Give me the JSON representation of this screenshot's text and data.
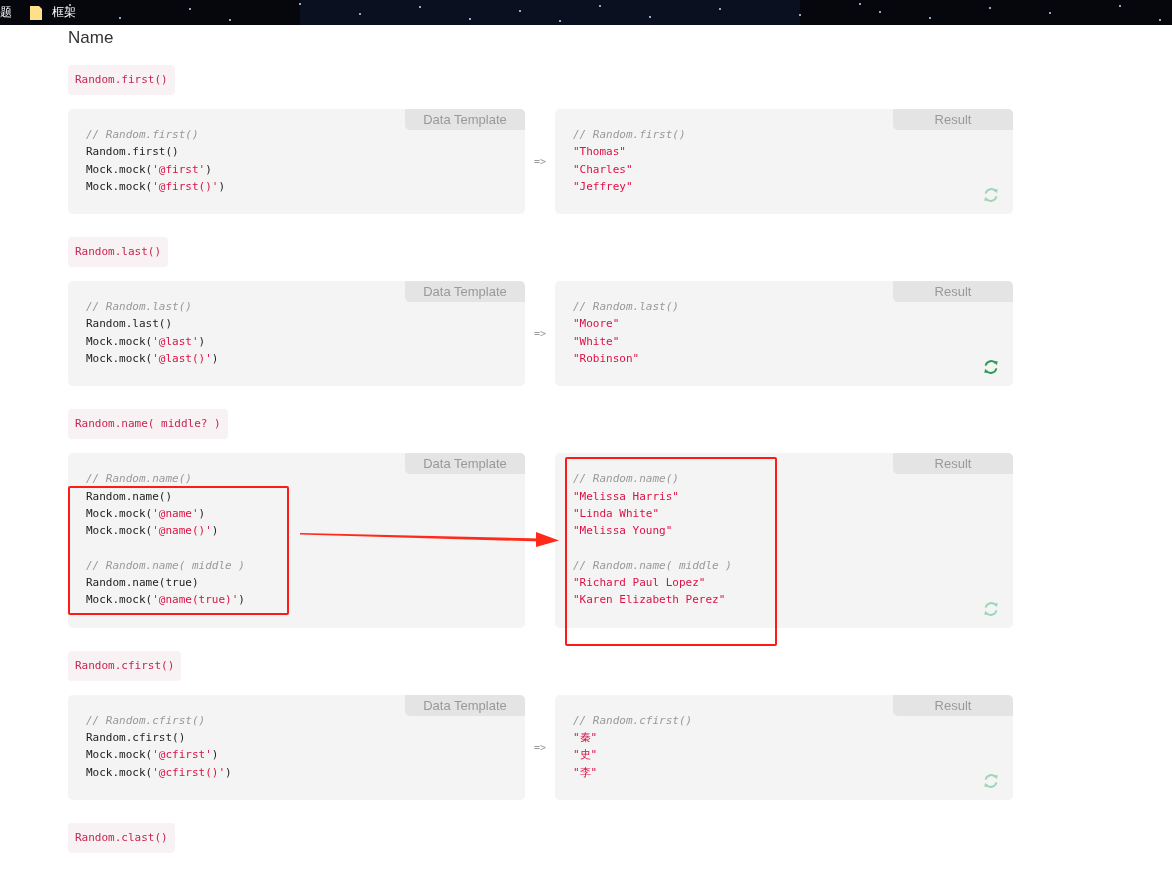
{
  "bookmarks_bar": {
    "items": [
      {
        "label": "题",
        "kind": "text"
      },
      {
        "label": "框架",
        "kind": "folder"
      }
    ]
  },
  "heading": "Name",
  "sections": [
    {
      "label": "Random.first()",
      "template_tab": "Data Template",
      "result_tab": "Result",
      "arrow_text": "=>",
      "annotated": false,
      "refresh_active": false,
      "template": [
        {
          "kind": "comment",
          "text": "// Random.first()"
        },
        {
          "kind": "code",
          "parts": [
            {
              "kind": "plain",
              "text": "Random.first()"
            }
          ]
        },
        {
          "kind": "code",
          "parts": [
            {
              "kind": "plain",
              "text": "Mock.mock("
            },
            {
              "kind": "string",
              "text": "'@first'"
            },
            {
              "kind": "plain",
              "text": ")"
            }
          ]
        },
        {
          "kind": "code",
          "parts": [
            {
              "kind": "plain",
              "text": "Mock.mock("
            },
            {
              "kind": "string",
              "text": "'@first()'"
            },
            {
              "kind": "plain",
              "text": ")"
            }
          ]
        }
      ],
      "result": [
        {
          "kind": "comment",
          "text": "// Random.first()"
        },
        {
          "kind": "string",
          "text": "\"Thomas\""
        },
        {
          "kind": "string",
          "text": "\"Charles\""
        },
        {
          "kind": "string",
          "text": "\"Jeffrey\""
        }
      ]
    },
    {
      "label": "Random.last()",
      "template_tab": "Data Template",
      "result_tab": "Result",
      "arrow_text": "=>",
      "annotated": false,
      "refresh_active": true,
      "template": [
        {
          "kind": "comment",
          "text": "// Random.last()"
        },
        {
          "kind": "code",
          "parts": [
            {
              "kind": "plain",
              "text": "Random.last()"
            }
          ]
        },
        {
          "kind": "code",
          "parts": [
            {
              "kind": "plain",
              "text": "Mock.mock("
            },
            {
              "kind": "string",
              "text": "'@last'"
            },
            {
              "kind": "plain",
              "text": ")"
            }
          ]
        },
        {
          "kind": "code",
          "parts": [
            {
              "kind": "plain",
              "text": "Mock.mock("
            },
            {
              "kind": "string",
              "text": "'@last()'"
            },
            {
              "kind": "plain",
              "text": ")"
            }
          ]
        }
      ],
      "result": [
        {
          "kind": "comment",
          "text": "// Random.last()"
        },
        {
          "kind": "string",
          "text": "\"Moore\""
        },
        {
          "kind": "string",
          "text": "\"White\""
        },
        {
          "kind": "string",
          "text": "\"Robinson\""
        }
      ]
    },
    {
      "label": "Random.name( middle? )",
      "template_tab": "Data Template",
      "result_tab": "Result",
      "annotated": true,
      "refresh_active": false,
      "template": [
        {
          "kind": "comment",
          "text": "// Random.name()"
        },
        {
          "kind": "code",
          "parts": [
            {
              "kind": "plain",
              "text": "Random.name()"
            }
          ]
        },
        {
          "kind": "code",
          "parts": [
            {
              "kind": "plain",
              "text": "Mock.mock("
            },
            {
              "kind": "string",
              "text": "'@name'"
            },
            {
              "kind": "plain",
              "text": ")"
            }
          ]
        },
        {
          "kind": "code",
          "parts": [
            {
              "kind": "plain",
              "text": "Mock.mock("
            },
            {
              "kind": "string",
              "text": "'@name()'"
            },
            {
              "kind": "plain",
              "text": ")"
            }
          ]
        },
        {
          "kind": "blank"
        },
        {
          "kind": "comment",
          "text": "// Random.name( middle )"
        },
        {
          "kind": "code",
          "parts": [
            {
              "kind": "plain",
              "text": "Random.name(true)"
            }
          ]
        },
        {
          "kind": "code",
          "parts": [
            {
              "kind": "plain",
              "text": "Mock.mock("
            },
            {
              "kind": "string",
              "text": "'@name(true)'"
            },
            {
              "kind": "plain",
              "text": ")"
            }
          ]
        }
      ],
      "result": [
        {
          "kind": "comment",
          "text": "// Random.name()"
        },
        {
          "kind": "string",
          "text": "\"Melissa Harris\""
        },
        {
          "kind": "string",
          "text": "\"Linda White\""
        },
        {
          "kind": "string",
          "text": "\"Melissa Young\""
        },
        {
          "kind": "blank"
        },
        {
          "kind": "comment",
          "text": "// Random.name( middle )"
        },
        {
          "kind": "string",
          "text": "\"Richard Paul Lopez\""
        },
        {
          "kind": "string",
          "text": "\"Karen Elizabeth Perez\""
        }
      ]
    },
    {
      "label": "Random.cfirst()",
      "template_tab": "Data Template",
      "result_tab": "Result",
      "arrow_text": "=>",
      "annotated": false,
      "refresh_active": false,
      "template": [
        {
          "kind": "comment",
          "text": "// Random.cfirst()"
        },
        {
          "kind": "code",
          "parts": [
            {
              "kind": "plain",
              "text": "Random.cfirst()"
            }
          ]
        },
        {
          "kind": "code",
          "parts": [
            {
              "kind": "plain",
              "text": "Mock.mock("
            },
            {
              "kind": "string",
              "text": "'@cfirst'"
            },
            {
              "kind": "plain",
              "text": ")"
            }
          ]
        },
        {
          "kind": "code",
          "parts": [
            {
              "kind": "plain",
              "text": "Mock.mock("
            },
            {
              "kind": "string",
              "text": "'@cfirst()'"
            },
            {
              "kind": "plain",
              "text": ")"
            }
          ]
        }
      ],
      "result": [
        {
          "kind": "comment",
          "text": "// Random.cfirst()"
        },
        {
          "kind": "string",
          "text": "\"秦\""
        },
        {
          "kind": "string",
          "text": "\"史\""
        },
        {
          "kind": "string",
          "text": "\"李\""
        }
      ]
    }
  ],
  "next_label": "Random.clast()"
}
